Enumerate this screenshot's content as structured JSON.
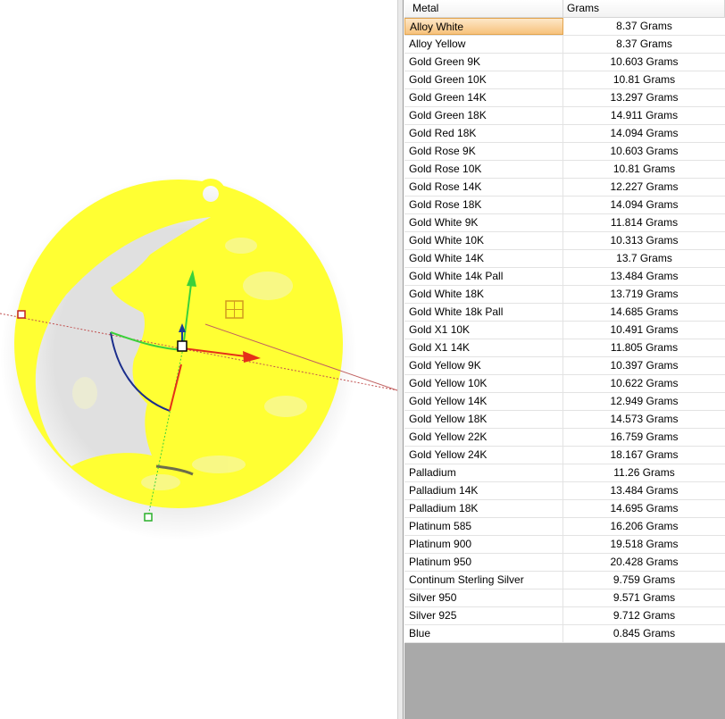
{
  "grid": {
    "headers": {
      "metal": "Metal",
      "grams": "Grams"
    },
    "selected_index": 0,
    "selection_color": "#f7c27c",
    "rows": [
      {
        "metal": "Alloy White",
        "grams": "8.37 Grams"
      },
      {
        "metal": "Alloy Yellow",
        "grams": "8.37 Grams"
      },
      {
        "metal": "Gold Green 9K",
        "grams": "10.603 Grams"
      },
      {
        "metal": "Gold Green 10K",
        "grams": "10.81 Grams"
      },
      {
        "metal": "Gold Green 14K",
        "grams": "13.297 Grams"
      },
      {
        "metal": "Gold Green 18K",
        "grams": "14.911 Grams"
      },
      {
        "metal": "Gold Red 18K",
        "grams": "14.094 Grams"
      },
      {
        "metal": "Gold Rose 9K",
        "grams": "10.603 Grams"
      },
      {
        "metal": "Gold Rose 10K",
        "grams": "10.81 Grams"
      },
      {
        "metal": "Gold Rose 14K",
        "grams": "12.227 Grams"
      },
      {
        "metal": "Gold Rose 18K",
        "grams": "14.094 Grams"
      },
      {
        "metal": "Gold White 9K",
        "grams": "11.814 Grams"
      },
      {
        "metal": "Gold White 10K",
        "grams": "10.313 Grams"
      },
      {
        "metal": "Gold White 14K",
        "grams": "13.7 Grams"
      },
      {
        "metal": "Gold White 14k Pall",
        "grams": "13.484 Grams"
      },
      {
        "metal": "Gold White 18K",
        "grams": "13.719 Grams"
      },
      {
        "metal": "Gold White 18k Pall",
        "grams": "14.685 Grams"
      },
      {
        "metal": "Gold X1 10K",
        "grams": "10.491 Grams"
      },
      {
        "metal": "Gold X1 14K",
        "grams": "11.805 Grams"
      },
      {
        "metal": "Gold Yellow 9K",
        "grams": "10.397 Grams"
      },
      {
        "metal": "Gold Yellow 10K",
        "grams": "10.622 Grams"
      },
      {
        "metal": "Gold Yellow 14K",
        "grams": "12.949 Grams"
      },
      {
        "metal": "Gold Yellow 18K",
        "grams": "14.573 Grams"
      },
      {
        "metal": "Gold Yellow 22K",
        "grams": "16.759 Grams"
      },
      {
        "metal": "Gold Yellow 24K",
        "grams": "18.167 Grams"
      },
      {
        "metal": "Palladium",
        "grams": "11.26 Grams"
      },
      {
        "metal": "Palladium 14K",
        "grams": "13.484 Grams"
      },
      {
        "metal": "Palladium 18K",
        "grams": "14.695 Grams"
      },
      {
        "metal": "Platinum 585",
        "grams": "16.206 Grams"
      },
      {
        "metal": "Platinum 900",
        "grams": "19.518 Grams"
      },
      {
        "metal": "Platinum 950",
        "grams": "20.428 Grams"
      },
      {
        "metal": "Continum Sterling Silver",
        "grams": "9.759 Grams"
      },
      {
        "metal": "Silver 950",
        "grams": "9.571 Grams"
      },
      {
        "metal": "Silver 925",
        "grams": "9.712 Grams"
      },
      {
        "metal": "Blue",
        "grams": "0.845 Grams"
      }
    ]
  },
  "viewport": {
    "model_color": "#ffff33",
    "gizmo_colors": {
      "x_axis": "#e53018",
      "y_axis": "#3ad13a",
      "z_axis": "#1a3a9a",
      "rotate_ring": "#1b2e8c"
    },
    "gizmo_icons": [
      "move-arrow-x-icon",
      "move-arrow-y-icon",
      "move-arrow-z-icon",
      "rotate-ring-icon",
      "scale-handle-icon",
      "plane-handle-icon",
      "pivot-lock-icon"
    ]
  }
}
